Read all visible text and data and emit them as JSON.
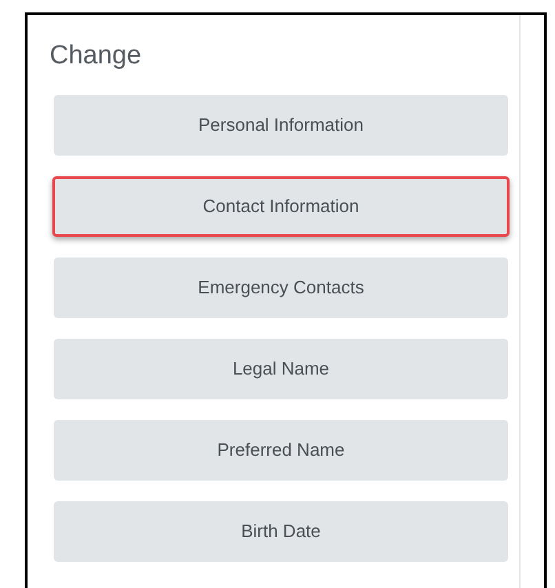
{
  "title": "Change",
  "options": [
    {
      "label": "Personal Information",
      "selected": false
    },
    {
      "label": "Contact Information",
      "selected": true
    },
    {
      "label": "Emergency Contacts",
      "selected": false
    },
    {
      "label": "Legal Name",
      "selected": false
    },
    {
      "label": "Preferred Name",
      "selected": false
    },
    {
      "label": "Birth Date",
      "selected": false
    }
  ]
}
